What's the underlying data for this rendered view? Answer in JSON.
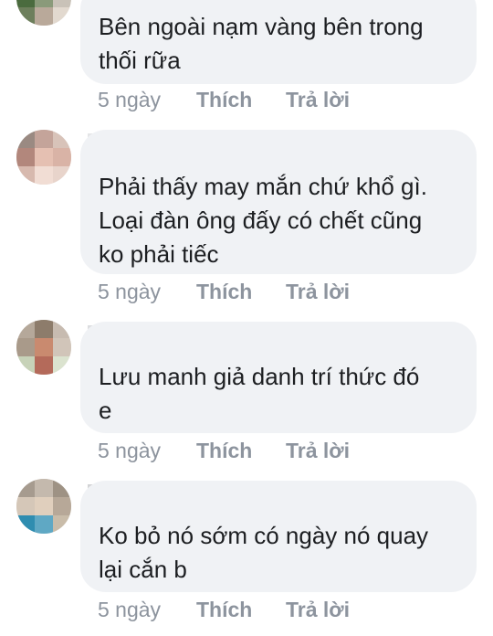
{
  "comments": [
    {
      "text_lines": [
        "Bên ngoài nạm vàng bên trong",
        "thối rữa"
      ],
      "time": "5 ngày",
      "like_label": "Thích",
      "reply_label": "Trả lời"
    },
    {
      "text_lines": [
        "Phải thấy may mắn chứ khổ gì.",
        "Loại đàn ông đấy có chết cũng",
        "ko phải tiếc"
      ],
      "time": "5 ngày",
      "like_label": "Thích",
      "reply_label": "Trả lời"
    },
    {
      "text_lines": [
        "Lưu manh giả danh trí thức đó",
        "e"
      ],
      "time": "5 ngày",
      "like_label": "Thích",
      "reply_label": "Trả lời"
    },
    {
      "text_lines": [
        "Ko bỏ nó sớm có ngày nó quay",
        "lại cắn b"
      ],
      "time": "5 ngày",
      "like_label": "Thích",
      "reply_label": "Trả lời"
    }
  ],
  "colors": {
    "bubble": "#f0f2f5",
    "text": "#1c1e21",
    "meta": "#8d949e"
  }
}
